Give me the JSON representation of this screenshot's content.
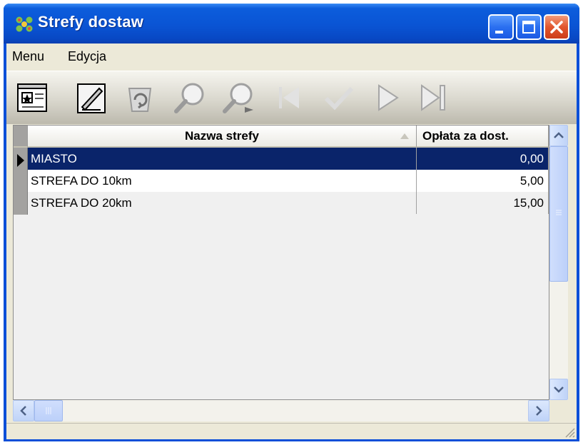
{
  "window": {
    "title": "Strefy dostaw"
  },
  "menu": {
    "items": [
      "Menu",
      "Edycja"
    ]
  },
  "toolbar": {
    "buttons": [
      "new-record-icon",
      "edit-icon",
      "refresh-icon",
      "search-icon",
      "search-next-icon",
      "first-record-icon",
      "check-icon",
      "next-record-icon",
      "last-record-icon"
    ]
  },
  "table": {
    "columns": [
      "Nazwa strefy",
      "Opłata za dost."
    ],
    "rows": [
      {
        "name": "MIASTO",
        "fee": "0,00"
      },
      {
        "name": "STREFA DO 10km",
        "fee": "5,00"
      },
      {
        "name": "STREFA DO 20km",
        "fee": "15,00"
      }
    ],
    "selected_row": 0
  },
  "colors": {
    "title_blue": "#0a54d4",
    "selection": "#0a246a",
    "close_red": "#e2562e"
  }
}
